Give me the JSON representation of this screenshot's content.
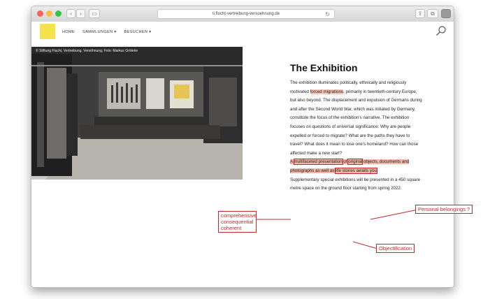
{
  "browser": {
    "url": "ti.flucht-vertreibung-versoehnung.de"
  },
  "nav": {
    "items": [
      "HOME",
      "SAMMLUNGEN ▾",
      "BESUCHEN ▾"
    ]
  },
  "photo": {
    "caption": "© Stiftung Flucht, Vertreibung, Versöhnung; Foto: Markus Gröteke"
  },
  "article": {
    "title": "The Exhibition",
    "p1_a": "The exhibition illuminates politically, ethnically and religiously motivated ",
    "p1_hl": "forced migrations",
    "p1_b": ", primarily in twentieth-century Europe, but also beyond. The displacement and expulsion of Germans during and after the Second World War, which was initiated by Germany, constitute the focus of the exhibition's narrative. The exhibition focuses on questions of universal significance: Why are people expelled or forced to migrate? What are the paths they have to travel? What does it mean to lose one's homeland? How can those affected make a new start?",
    "p2_a": "A ",
    "p2_box1": "multifaceted presentation",
    "p2_mid1": " of ",
    "p2_box2": "original",
    "p2_mid2": " objects, documents and photographs as well as ",
    "p2_box3": "life stories awaits you",
    "p2_end": ".",
    "p3": "Supplementary special exhibitions will be presented in a 450 square metre space on the ground floor starting from spring 2022."
  },
  "annotations": {
    "left": [
      "comprehensive",
      "consequential",
      "coherent"
    ],
    "right": "Personal belongings ?",
    "bottom": "Objectification"
  },
  "colors": {
    "annotation_red": "#c3282c",
    "highlight": "#f3c7b8",
    "logo_yellow": "#f4e24c"
  }
}
